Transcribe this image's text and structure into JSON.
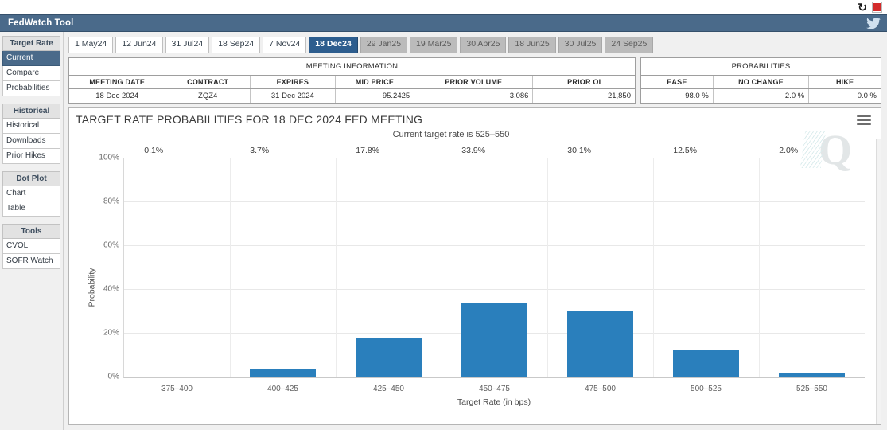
{
  "topbar": {
    "refresh_icon": "refresh-icon",
    "pdf_icon": "pdf-icon"
  },
  "header": {
    "title": "FedWatch Tool",
    "twitter_icon": "twitter-icon",
    "accent_color": "#4a6a8a"
  },
  "sidebar": {
    "groups": [
      {
        "title": "Target Rate",
        "items": [
          {
            "label": "Current",
            "active": true
          },
          {
            "label": "Compare",
            "active": false
          },
          {
            "label": "Probabilities",
            "active": false
          }
        ]
      },
      {
        "title": "Historical",
        "items": [
          {
            "label": "Historical",
            "active": false
          },
          {
            "label": "Downloads",
            "active": false
          },
          {
            "label": "Prior Hikes",
            "active": false
          }
        ]
      },
      {
        "title": "Dot Plot",
        "items": [
          {
            "label": "Chart",
            "active": false
          },
          {
            "label": "Table",
            "active": false
          }
        ]
      },
      {
        "title": "Tools",
        "items": [
          {
            "label": "CVOL",
            "active": false
          },
          {
            "label": "SOFR Watch",
            "active": false
          }
        ]
      }
    ]
  },
  "tabs": [
    {
      "label": "1 May24",
      "state": "past"
    },
    {
      "label": "12 Jun24",
      "state": "past"
    },
    {
      "label": "31 Jul24",
      "state": "past"
    },
    {
      "label": "18 Sep24",
      "state": "past"
    },
    {
      "label": "7 Nov24",
      "state": "past"
    },
    {
      "label": "18 Dec24",
      "state": "active"
    },
    {
      "label": "29 Jan25",
      "state": "future"
    },
    {
      "label": "19 Mar25",
      "state": "future"
    },
    {
      "label": "30 Apr25",
      "state": "future"
    },
    {
      "label": "18 Jun25",
      "state": "future"
    },
    {
      "label": "30 Jul25",
      "state": "future"
    },
    {
      "label": "24 Sep25",
      "state": "future"
    }
  ],
  "meeting_information": {
    "title": "MEETING INFORMATION",
    "columns": [
      "MEETING DATE",
      "CONTRACT",
      "EXPIRES",
      "MID PRICE",
      "PRIOR VOLUME",
      "PRIOR OI"
    ],
    "row": {
      "meeting_date": "18 Dec 2024",
      "contract": "ZQZ4",
      "expires": "31 Dec 2024",
      "mid_price": "95.2425",
      "prior_volume": "3,086",
      "prior_oi": "21,850"
    }
  },
  "probabilities": {
    "title": "PROBABILITIES",
    "columns": [
      "EASE",
      "NO CHANGE",
      "HIKE"
    ],
    "row": {
      "ease": "98.0 %",
      "no_change": "2.0 %",
      "hike": "0.0 %"
    }
  },
  "chart_panel": {
    "title": "TARGET RATE PROBABILITIES FOR 18 DEC 2024 FED MEETING",
    "subtitle": "Current target rate is 525–550",
    "menu_icon": "hamburger-menu-icon",
    "watermark": "Q"
  },
  "chart_data": {
    "type": "bar",
    "title": "TARGET RATE PROBABILITIES FOR 18 DEC 2024 FED MEETING",
    "subtitle": "Current target rate is 525–550",
    "xlabel": "Target Rate (in bps)",
    "ylabel": "Probability",
    "categories": [
      "375–400",
      "400–425",
      "425–450",
      "450–475",
      "475–500",
      "500–525",
      "525–550"
    ],
    "values": [
      0.1,
      3.7,
      17.8,
      33.9,
      30.1,
      12.5,
      2.0
    ],
    "value_labels": [
      "0.1%",
      "3.7%",
      "17.8%",
      "33.9%",
      "30.1%",
      "12.5%",
      "2.0%"
    ],
    "ylim": [
      0,
      100
    ],
    "yticks": [
      0,
      20,
      40,
      60,
      80,
      100
    ],
    "ytick_labels": [
      "0%",
      "20%",
      "40%",
      "60%",
      "80%",
      "100%"
    ],
    "grid": true,
    "legend": "none",
    "bar_color": "#2a7fbc"
  }
}
